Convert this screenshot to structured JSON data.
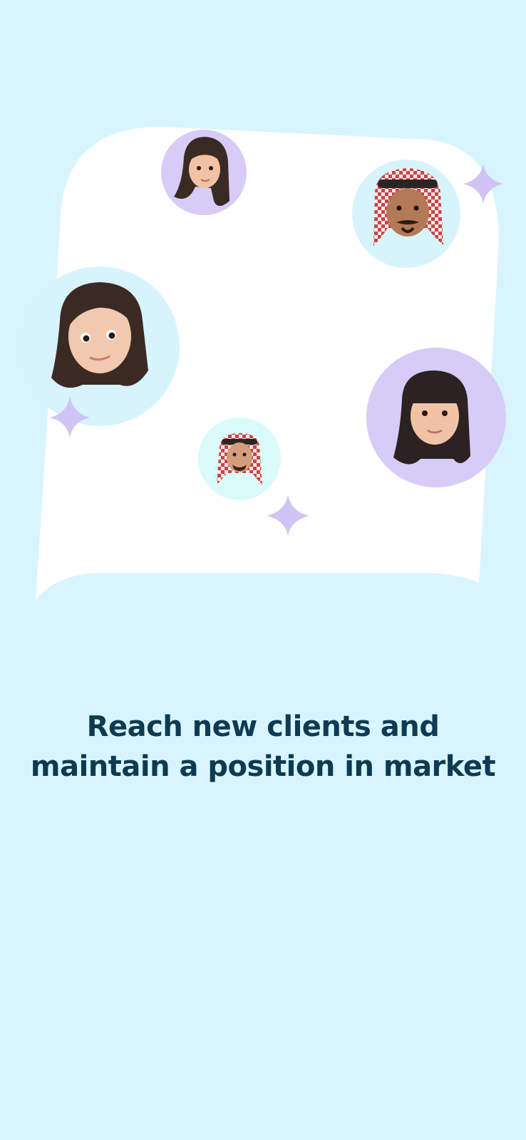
{
  "onboarding": {
    "headline_line1": "Reach new clients and",
    "headline_line2": "maintain a position in market"
  },
  "colors": {
    "background": "#d8f5ff",
    "card": "#ffffff",
    "headline": "#0e3a52",
    "avatar_lavender": "#d6ccf7",
    "avatar_cyan": "#d7f4fd",
    "avatar_mint": "#d9fbf9",
    "sparkle": "#cfc5f4"
  },
  "illustration": {
    "avatars": [
      {
        "icon": "woman-memoji-icon",
        "bg": "lavender"
      },
      {
        "icon": "man-keffiyeh-memoji-icon",
        "bg": "cyan"
      },
      {
        "icon": "woman-long-hair-memoji-icon",
        "bg": "cyan"
      },
      {
        "icon": "woman-bangs-memoji-icon",
        "bg": "lavender"
      },
      {
        "icon": "man-keffiyeh-small-memoji-icon",
        "bg": "mint"
      }
    ],
    "sparkles": [
      "sparkle-icon",
      "sparkle-icon",
      "sparkle-icon"
    ]
  }
}
